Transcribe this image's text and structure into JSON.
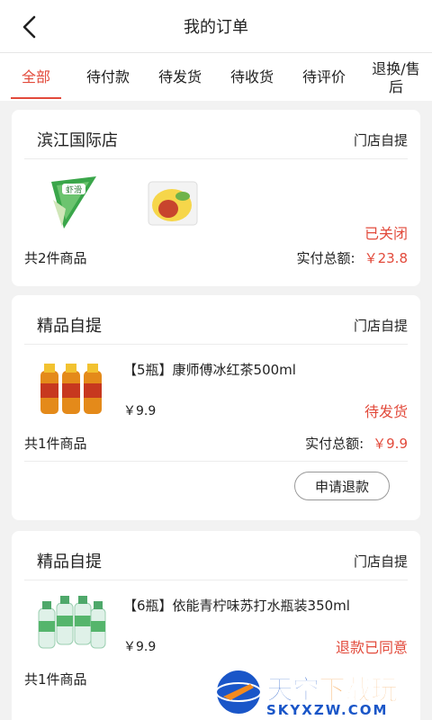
{
  "header": {
    "title": "我的订单"
  },
  "tabs": [
    {
      "label": "全部",
      "active": true
    },
    {
      "label": "待付款"
    },
    {
      "label": "待发货"
    },
    {
      "label": "待收货"
    },
    {
      "label": "待评价"
    },
    {
      "label": "退换/售后"
    }
  ],
  "orders": [
    {
      "store": "滨江国际店",
      "pickup": "门店自提",
      "status": "已关闭",
      "count": "共2件商品",
      "total_label": "实付总额:",
      "total": "￥23.8",
      "thumbs": [
        "shrimp-snack-icon",
        "egg-snack-icon"
      ]
    },
    {
      "store": "精品自提",
      "pickup": "门店自提",
      "product": "【5瓶】康师傅冰红茶500ml",
      "price": "￥9.9",
      "status": "待发货",
      "count": "共1件商品",
      "total_label": "实付总额:",
      "total": "￥9.9",
      "button": "申请退款",
      "thumbs": [
        "ice-tea-bottles-icon"
      ]
    },
    {
      "store": "精品自提",
      "pickup": "门店自提",
      "product": "【6瓶】依能青柠味苏打水瓶装350ml",
      "price": "￥9.9",
      "status": "退款已同意",
      "count": "共1件商品",
      "thumbs": [
        "soda-water-bottles-icon"
      ]
    }
  ],
  "watermark": {
    "big_1": "天空",
    "big_2": "下载玩",
    "small": "SKYXZW.COM"
  },
  "colors": {
    "accent": "#e24a3b",
    "background": "#f2f2f2",
    "watermark": "#1a56c8"
  }
}
